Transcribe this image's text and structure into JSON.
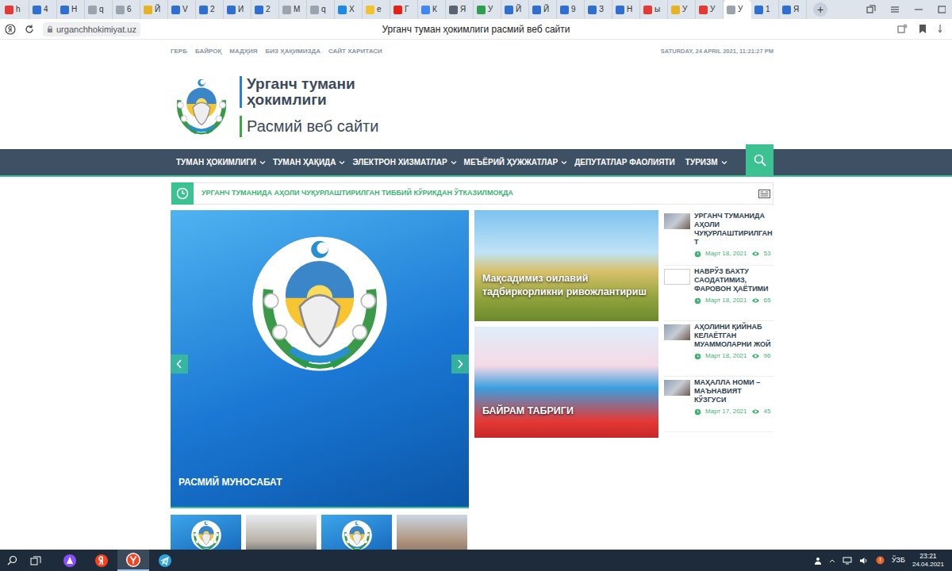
{
  "browser": {
    "tabs": [
      {
        "label": "h",
        "selected": false,
        "color": "#e53935"
      },
      {
        "label": "4",
        "selected": false,
        "color": "#2f6fd1"
      },
      {
        "label": "Н",
        "selected": false,
        "color": "#2f6fd1"
      },
      {
        "label": "q",
        "selected": false,
        "color": "#9aa4ae"
      },
      {
        "label": "6",
        "selected": false,
        "color": "#9aa4ae"
      },
      {
        "label": "Й",
        "selected": false,
        "color": "#e6b422"
      },
      {
        "label": "V",
        "selected": false,
        "color": "#2f6fd1"
      },
      {
        "label": "2",
        "selected": false,
        "color": "#2f6fd1"
      },
      {
        "label": "И",
        "selected": false,
        "color": "#2f6fd1"
      },
      {
        "label": "2",
        "selected": false,
        "color": "#2f6fd1"
      },
      {
        "label": "М",
        "selected": false,
        "color": "#9aa4ae"
      },
      {
        "label": "q",
        "selected": false,
        "color": "#9aa4ae"
      },
      {
        "label": "Х",
        "selected": false,
        "color": "#1e88e5"
      },
      {
        "label": "е",
        "selected": false,
        "color": "#f2c230"
      },
      {
        "label": "Г",
        "selected": false,
        "color": "#e62117"
      },
      {
        "label": "К",
        "selected": false,
        "color": "#4285f4"
      },
      {
        "label": "Я",
        "selected": false,
        "color": "#5a6470"
      },
      {
        "label": "У",
        "selected": false,
        "color": "#2e9e4f"
      },
      {
        "label": "Й",
        "selected": false,
        "color": "#2f6fd1"
      },
      {
        "label": "Й",
        "selected": false,
        "color": "#2f6fd1"
      },
      {
        "label": "9",
        "selected": false,
        "color": "#2f6fd1"
      },
      {
        "label": "З",
        "selected": false,
        "color": "#2f6fd1"
      },
      {
        "label": "Н",
        "selected": false,
        "color": "#2f6fd1"
      },
      {
        "label": "ы",
        "selected": false,
        "color": "#e53935"
      },
      {
        "label": "У",
        "selected": false,
        "color": "#e6b422"
      },
      {
        "label": "У",
        "selected": false,
        "color": "#e53935"
      },
      {
        "label": "У",
        "selected": true,
        "color": "#9aa4ae"
      },
      {
        "label": "1",
        "selected": false,
        "color": "#2f6fd1"
      },
      {
        "label": "Я",
        "selected": false,
        "color": "#2f6fd1"
      }
    ],
    "new_tab": "+",
    "address": "urganchhokimiyat.uz",
    "title": "Урганч туман ҳокимлиги расмий веб сайти"
  },
  "page": {
    "top_links": [
      "ГЕРБ",
      "БАЙРОҚ",
      "МАДҲИЯ",
      "БИЗ ҲАҚИМИЗДА",
      "САЙТ ХАРИТАСИ"
    ],
    "datetime": "SATURDAY, 24 APRIL 2021, 11:21:27 PM",
    "logo": {
      "line1": "Урганч тумани",
      "line2": "ҳокимлиги",
      "line3": "Расмий веб сайти"
    },
    "nav": [
      {
        "label": "ТУМАН ҲОКИМЛИГИ",
        "dropdown": true
      },
      {
        "label": "ТУМАН ҲАҚИДА",
        "dropdown": true
      },
      {
        "label": "ЭЛЕКТРОН ХИЗМАТЛАР",
        "dropdown": true
      },
      {
        "label": "МЕЪЁРИЙ ҲУЖЖАТЛАР",
        "dropdown": true
      },
      {
        "label": "ДЕПУТАТЛАР ФАОЛИЯТИ",
        "dropdown": false
      },
      {
        "label": "ТУРИЗМ",
        "dropdown": true
      }
    ],
    "ticker": "УРГАНЧ ТУМАНИДА АҲОЛИ ЧУҚУРЛАШТИРИЛГАН ТИББИЙ КЎРИКДАН ЎТКАЗИЛМОҚДА",
    "slider": {
      "caption": "РАСМИЙ МУНОСАБАТ"
    },
    "cards": [
      {
        "caption": "Мақсадимиз оилавий тадбиркорликни ривожлантириш",
        "kind": "field"
      },
      {
        "caption": "БАЙРАМ ТАБРИГИ",
        "kind": "holiday"
      }
    ],
    "news": [
      {
        "title": "УРГАНЧ ТУМАНИДА АҲОЛИ ЧУҚУРЛАШТИРИЛГАН Т",
        "date": "Март 18, 2021",
        "views": "53",
        "kind": "photo"
      },
      {
        "title": "НАВРЎЗ БАХТУ САОДАТИМИЗ, ФАРОВОН ҲАЁТИМИ",
        "date": "Март 18, 2021",
        "views": "65",
        "kind": "broken"
      },
      {
        "title": "АҲОЛИНИ ҚИЙНАБ КЕЛАЁТГАН МУАММОЛАРНИ ЖОЙ",
        "date": "Март 18, 2021",
        "views": "96",
        "kind": "photo"
      },
      {
        "title": "МАҲАЛЛА НОМИ – МАЪНАВИЯТ КЎЗГУСИ",
        "date": "Март 17, 2021",
        "views": "45",
        "kind": "photo"
      }
    ],
    "thumbnails": [
      {
        "kind": "emblem"
      },
      {
        "kind": "photo"
      },
      {
        "kind": "emblem"
      },
      {
        "kind": "building"
      }
    ]
  },
  "taskbar": {
    "apps": [
      {
        "kind": "alice",
        "selected": false
      },
      {
        "kind": "yandex",
        "selected": false
      },
      {
        "kind": "browser",
        "selected": true
      },
      {
        "kind": "telegram",
        "selected": false
      }
    ],
    "language": "ЎЗБ",
    "time": "23:21",
    "date": "24.04.2021"
  }
}
